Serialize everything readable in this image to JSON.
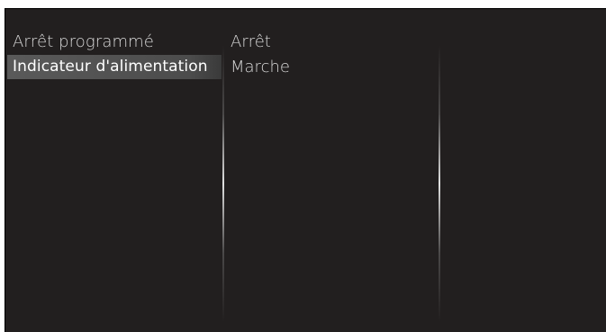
{
  "menu": {
    "items": [
      {
        "label": "Arrêt programmé",
        "selected": false
      },
      {
        "label": "Indicateur d'alimentation",
        "selected": true
      }
    ]
  },
  "options": {
    "items": [
      {
        "label": "Arrêt"
      },
      {
        "label": "Marche"
      }
    ]
  },
  "colors": {
    "background": "#221f1f",
    "selection": "#555555",
    "text": "#d8d8d8",
    "selected_text": "#ffffff"
  }
}
